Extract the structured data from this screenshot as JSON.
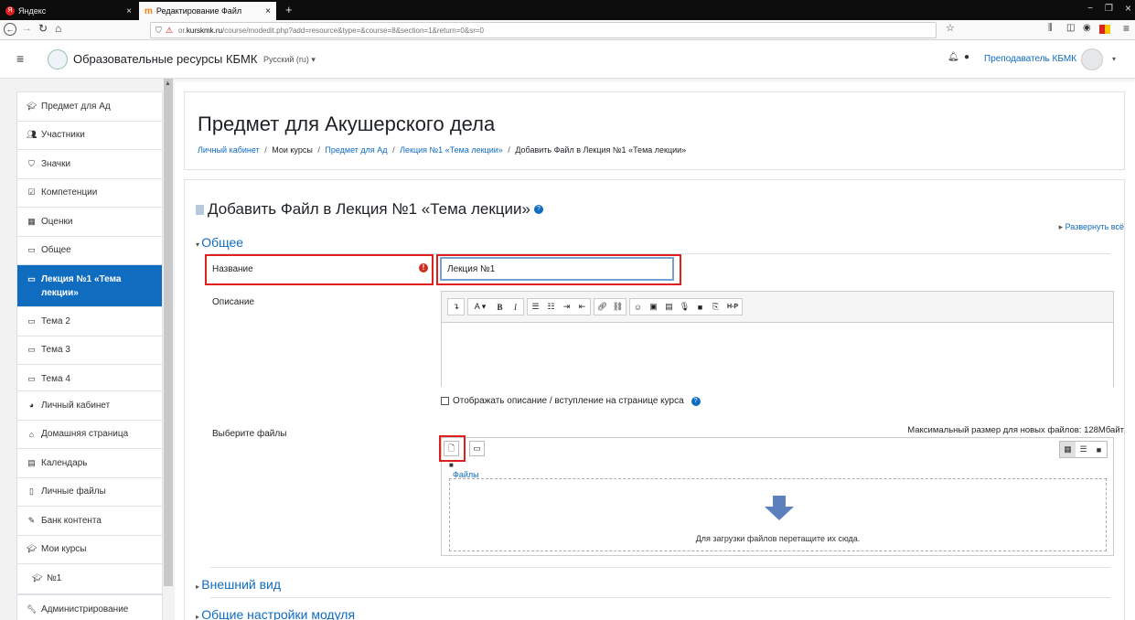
{
  "browser": {
    "tabs": [
      {
        "label": "Яндекс"
      },
      {
        "label": "Редактирование Файл"
      }
    ],
    "url_prefix": "or.",
    "url_domain": "kurskmk.ru",
    "url_path": "/course/modedit.php?add=resource&type=&course=8&section=1&return=0&sr=0",
    "controls": {
      "minimize": "−",
      "restore": "❐",
      "close": "×"
    }
  },
  "header": {
    "site_name": "Образовательные ресурсы КБМК",
    "language": "Русский (ru) ▾",
    "user_name": "Преподаватель КБМК",
    "user_menu": "▾"
  },
  "drawer": {
    "group1": [
      {
        "label": "Предмет для Ад",
        "icon": "graduation-cap-icon"
      },
      {
        "label": "Участники",
        "icon": "users-icon"
      },
      {
        "label": "Значки",
        "icon": "shield-icon"
      },
      {
        "label": "Компетенции",
        "icon": "check-square-icon"
      },
      {
        "label": "Оценки",
        "icon": "table-icon"
      },
      {
        "label": "Общее",
        "icon": "folder-icon"
      },
      {
        "label": "Лекция №1 «Тема лекции»",
        "icon": "folder-icon",
        "active": true
      },
      {
        "label": "Тема 2",
        "icon": "folder-icon"
      },
      {
        "label": "Тема 3",
        "icon": "folder-icon"
      },
      {
        "label": "Тема 4",
        "icon": "folder-icon"
      }
    ],
    "group2": [
      {
        "label": "Личный кабинет",
        "icon": "dashboard-icon"
      },
      {
        "label": "Домашняя страница",
        "icon": "home-icon"
      },
      {
        "label": "Календарь",
        "icon": "calendar-icon"
      },
      {
        "label": "Личные файлы",
        "icon": "file-icon"
      },
      {
        "label": "Банк контента",
        "icon": "pen-icon"
      },
      {
        "label": "Мои курсы",
        "icon": "graduation-cap-icon"
      },
      {
        "label": "№1",
        "icon": "graduation-cap-icon"
      }
    ],
    "group3": [
      {
        "label": "Администрирование",
        "icon": "wrench-icon"
      }
    ]
  },
  "page": {
    "course_title": "Предмет для Акушерского дела",
    "breadcrumb": {
      "item1": "Личный кабинет",
      "item2": "Мои курсы",
      "item3": "Предмет для Ад",
      "item4": "Лекция №1 «Тема лекции»",
      "item5": "Добавить Файл в Лекция №1 «Тема лекции»",
      "separator": "/"
    },
    "form_title": "Добавить Файл в Лекция №1 «Тема лекции»",
    "expand_all": "Развернуть всё",
    "section_general": "Общее",
    "name_label": "Название",
    "name_value": "Лекция №1",
    "description_label": "Описание",
    "show_description_label": "Отображать описание / вступление на странице курса",
    "select_files_label": "Выберите файлы",
    "max_size": "Максимальный размер для новых файлов: 128Мбайт",
    "files_folder": "Файлы",
    "drop_hint": "Для загрузки файлов перетащите их сюда.",
    "section_appearance": "Внешний вид",
    "section_module": "Общие настройки модуля"
  },
  "colors": {
    "accent": "#0f6cbf",
    "highlight": "#e0201f",
    "required": "#ca3120"
  }
}
